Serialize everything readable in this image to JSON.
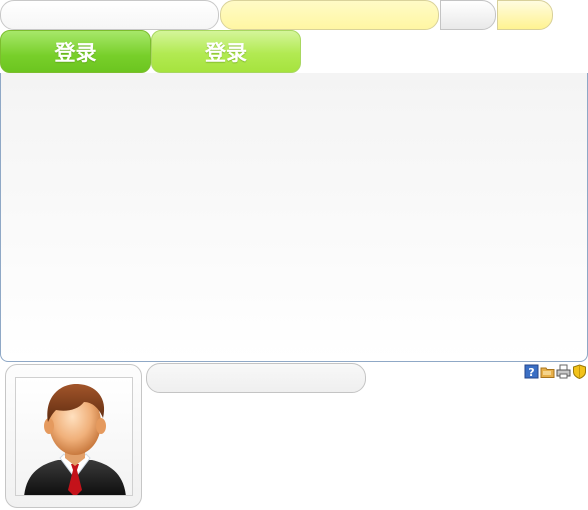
{
  "top_bar": {
    "username_value": "",
    "password_value": "",
    "buttons": [
      "",
      ""
    ]
  },
  "login": {
    "primary_label": "登录",
    "secondary_label": "登录"
  },
  "panel": {
    "content": ""
  },
  "status_icons": [
    "help-icon",
    "folder-icon",
    "printer-icon",
    "shield-icon"
  ],
  "profile": {
    "name_value": ""
  },
  "colors": {
    "accent_green": "#78cf2a",
    "accent_light_green": "#b2ea52",
    "input_yellow": "#fff6a3",
    "panel_border": "#8fa8c6"
  }
}
